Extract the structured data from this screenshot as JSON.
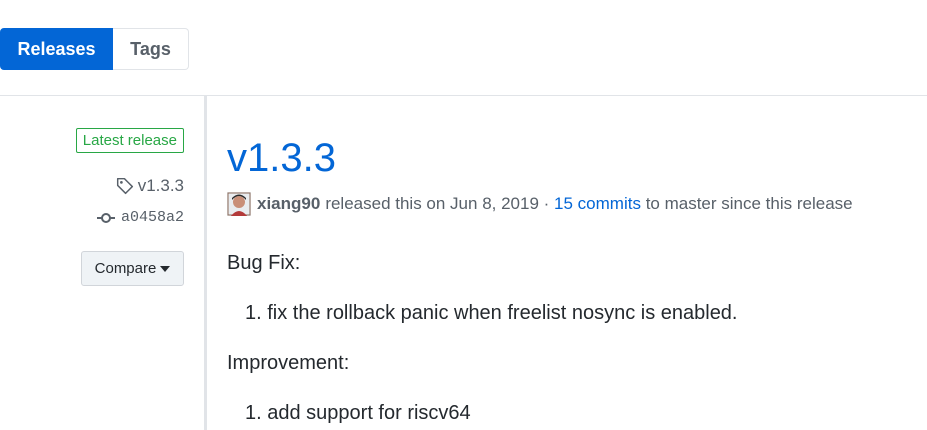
{
  "tabs": {
    "releases": "Releases",
    "tags": "Tags"
  },
  "sidebar": {
    "badge": "Latest release",
    "tag": "v1.3.3",
    "commit": "a0458a2",
    "compare": "Compare"
  },
  "release": {
    "title": "v1.3.3",
    "author": "xiang90",
    "released_text": "released this on Jun 8, 2019 ·",
    "commits_link": "15 commits",
    "since_text": "to master since this release",
    "section1_heading": "Bug Fix:",
    "section1_item": "1. fix the rollback panic when freelist nosync is enabled.",
    "section2_heading": "Improvement:",
    "section2_item": "1. add support for riscv64"
  },
  "colors": {
    "accent": "#0366d6",
    "latest_green": "#28a745"
  },
  "icons": {
    "tag": "tag-icon",
    "commit": "git-commit-icon",
    "compare": "caret-down-icon"
  }
}
